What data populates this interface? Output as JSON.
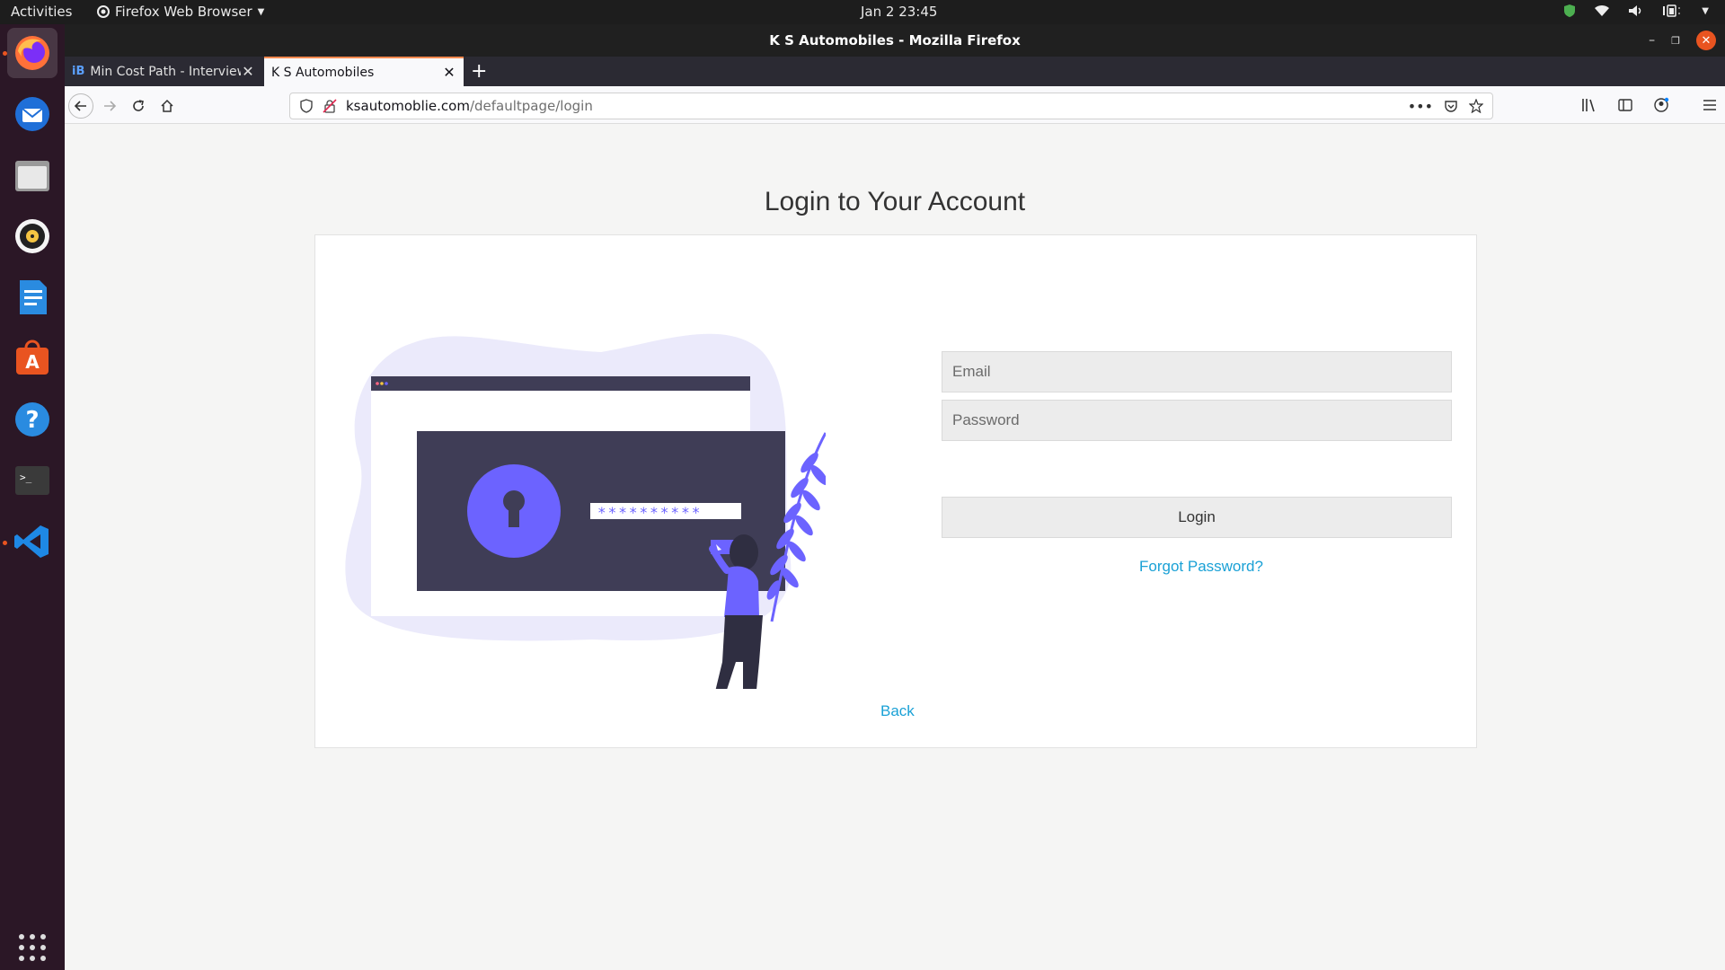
{
  "topbar": {
    "activities": "Activities",
    "app_menu": "Firefox Web Browser",
    "clock": "Jan 2  23:45",
    "tray_icons": [
      "shield-icon",
      "wifi-icon",
      "volume-icon",
      "battery-icon"
    ]
  },
  "dock": {
    "apps": [
      "firefox",
      "thunderbird",
      "files",
      "rhythmbox",
      "libreoffice-writer",
      "ubuntu-software",
      "help",
      "terminal",
      "vscode",
      "show-applications"
    ]
  },
  "window": {
    "title": "K S Automobiles - Mozilla Firefox",
    "tabs": [
      {
        "label": "Min Cost Path - Interview",
        "favicon": "iB",
        "active": false
      },
      {
        "label": "K S Automobiles",
        "favicon": "",
        "active": true
      }
    ],
    "url_domain": "ksautomoblie.com",
    "url_path": "/defaultpage/login"
  },
  "page": {
    "title": "Login to Your Account",
    "illustration_password": "**********",
    "email_placeholder": "Email",
    "password_placeholder": "Password",
    "login_label": "Login",
    "forgot_label": "Forgot Password?",
    "back_label": "Back"
  },
  "colors": {
    "accent_purple": "#6c63ff",
    "dark_panel": "#3f3d56",
    "link": "#1aa1d6",
    "ubuntu_orange": "#e95420"
  }
}
